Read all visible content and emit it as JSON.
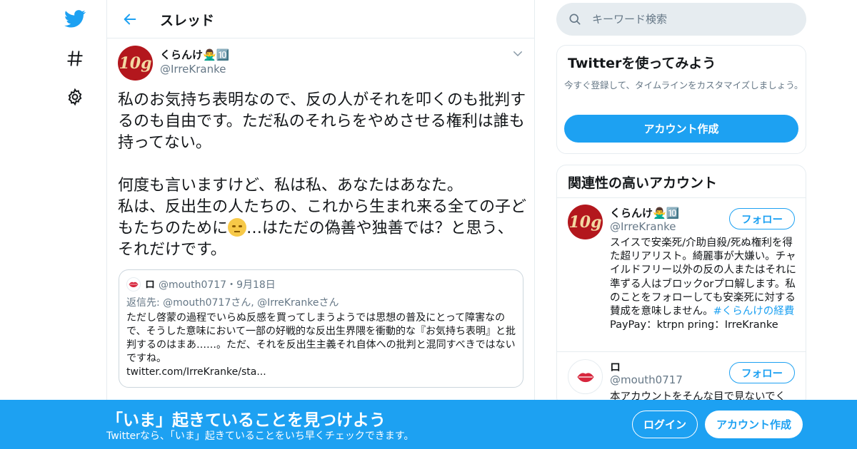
{
  "colors": {
    "accent": "#1da1f2",
    "text": "#14171a",
    "secondary": "#657786",
    "border": "#e6ecf0",
    "avatar_bg": "#b3171d"
  },
  "nav": {
    "logo_icon": "twitter-bird-icon",
    "explore_icon": "hashtag-icon",
    "settings_icon": "gear-icon"
  },
  "header": {
    "back_icon": "arrow-left-icon",
    "title": "スレッド"
  },
  "tweet": {
    "author_name": "くらんけ🙅‍♂️🔟",
    "author_handle": "@IrreKranke",
    "avatar_text": "10g",
    "text_part1": "私のお気持ち表明なので、反の人がそれを叩くのも批判するのも自由です。ただ私のそれらをやめさせる権利は誰も持ってない。\n\n何度も言いますけど、私は私、あなたはあなた。\n私は、反出生の人たちの、これから生まれ来る全ての子どもたちのために",
    "emoji_name": "rolling-eyes-emoji",
    "text_part2": "…はただの偽善や独善では？と思う、それだけです。",
    "quote": {
      "name": "ロ",
      "handle_date": "@mouth0717・9月18日",
      "reply_to": "返信先: @mouth0717さん, @IrreKrankeさん",
      "body": "ただし啓蒙の過程でいらぬ反感を買ってしまうようでは思想の普及にとって障害なので、そうした意味において一部の好戦的な反出生界隈を衝動的な『お気持ち表明』と批判するのはまあ……。ただ、それを反出生主義それ自体への批判と混同すべきではないですね。",
      "link": "twitter.com/IrreKranke/sta..."
    }
  },
  "search": {
    "placeholder": "キーワード検索",
    "icon": "search-icon"
  },
  "try_card": {
    "title": "Twitterを使ってみよう",
    "desc": "今すぐ登録して、タイムラインをカスタマイズしましょう。",
    "button": "アカウント作成"
  },
  "related": {
    "title": "関連性の高いアカウント",
    "accounts": [
      {
        "name": "くらんけ🙅‍♂️🔟",
        "handle": "@IrreKranke",
        "follow": "フォロー",
        "bio_text": "スイスで安楽死/介助自殺/死ぬ権利を得た超リアリスト。綺麗事が大嫌い。チャイルドフリー以外の反の人またはそれに準ずる人はブロックorプロ解します。私のことをフォローしても安楽死に対する賛成を意味しません。",
        "bio_hashtag": "#くらんけの経費",
        "bio_tail": " PayPay：ktrpn pring：IrreKranke"
      },
      {
        "name": "ロ",
        "handle": "@mouth0717",
        "follow": "フォロー",
        "bio_text": "本アカウントをそんな目で見ないでく"
      }
    ]
  },
  "banner": {
    "title": "「いま」起きていることを見つけよう",
    "subtitle": "Twitterなら、「いま」起きていることをいち早くチェックできます。",
    "login": "ログイン",
    "signup": "アカウント作成"
  }
}
